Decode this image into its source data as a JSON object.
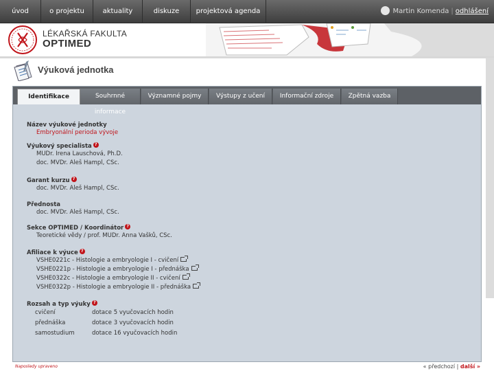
{
  "nav": {
    "items": [
      "úvod",
      "o projektu",
      "aktuality",
      "diskuze",
      "projektová agenda"
    ],
    "user_name": "Martin Komenda",
    "logout": "odhlášení"
  },
  "header": {
    "faculty_line1": "LÉKAŘSKÁ FAKULTA",
    "faculty_line2": "OPTIMED"
  },
  "page": {
    "title": "Výuková jednotka"
  },
  "tabs": [
    "Identifikace",
    "Souhrnné informace",
    "Významné pojmy",
    "Výstupy z učení",
    "Informační zdroje",
    "Zpětná vazba"
  ],
  "active_tab": "Identifikace",
  "sections": {
    "name": {
      "label": "Název výukové jednotky",
      "value": "Embryonální perioda vývoje"
    },
    "specialist": {
      "label": "Výukový specialista",
      "values": [
        "MUDr. Irena Lauschová, Ph.D.",
        "doc. MVDr. Aleš Hampl, CSc."
      ]
    },
    "garant": {
      "label": "Garant kurzu",
      "value": "doc. MVDr. Aleš Hampl, CSc."
    },
    "predseda": {
      "label": "Přednosta",
      "value": "doc. MVDr. Aleš Hampl, CSc."
    },
    "sekce": {
      "label": "Sekce OPTIMED / Koordinátor",
      "value": "Teoretické vědy / prof. MUDr. Anna Vašků, CSc."
    },
    "afiliace": {
      "label": "Afiliace k výuce",
      "values": [
        "VSHE0221c - Histologie a embryologie I - cvičení",
        "VSHE0221p - Histologie a embryologie I - přednáška",
        "VSHE0322c - Histologie a embryologie II - cvičení",
        "VSHE0322p - Histologie a embryologie II - přednáška"
      ]
    },
    "rozsah": {
      "label": "Rozsah a typ výuky",
      "rows": [
        {
          "type": "cvičení",
          "amount": "dotace 5 vyučovacích hodin"
        },
        {
          "type": "přednáška",
          "amount": "dotace 3 vyučovacích hodin"
        },
        {
          "type": "samostudium",
          "amount": "dotace 16 vyučovacích hodin"
        }
      ]
    }
  },
  "footer": {
    "left": "Naposledy upraveno",
    "prev": "předchozí",
    "next": "další"
  },
  "colors": {
    "accent_red": "#c0141a",
    "nav_bg": "#4a4a4a",
    "panel_bg": "#cdd5de"
  }
}
